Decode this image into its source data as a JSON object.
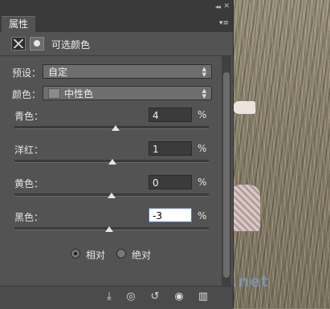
{
  "panel": {
    "tab_label": "属性",
    "collapse_glyph": "◂◂",
    "close_glyph": "✕",
    "menu_glyph": "▾≡",
    "header_title": "可选颜色"
  },
  "preset": {
    "label": "预设：",
    "value": "自定"
  },
  "colors": {
    "label": "颜色：",
    "value": "中性色"
  },
  "sliders": [
    {
      "label": "青色：",
      "value": "4",
      "unit": "%"
    },
    {
      "label": "洋红：",
      "value": "1",
      "unit": "%"
    },
    {
      "label": "黄色：",
      "value": "0",
      "unit": "%"
    },
    {
      "label": "黑色：",
      "value": "-3",
      "unit": "%"
    }
  ],
  "method": {
    "relative_label": "相对",
    "absolute_label": "绝对",
    "selected": "relative"
  },
  "watermark": {
    "text": "jb51.net"
  },
  "footer_icons": [
    "clip-to-layer-icon",
    "view-previous-icon",
    "reset-icon",
    "visibility-icon",
    "delete-icon"
  ]
}
